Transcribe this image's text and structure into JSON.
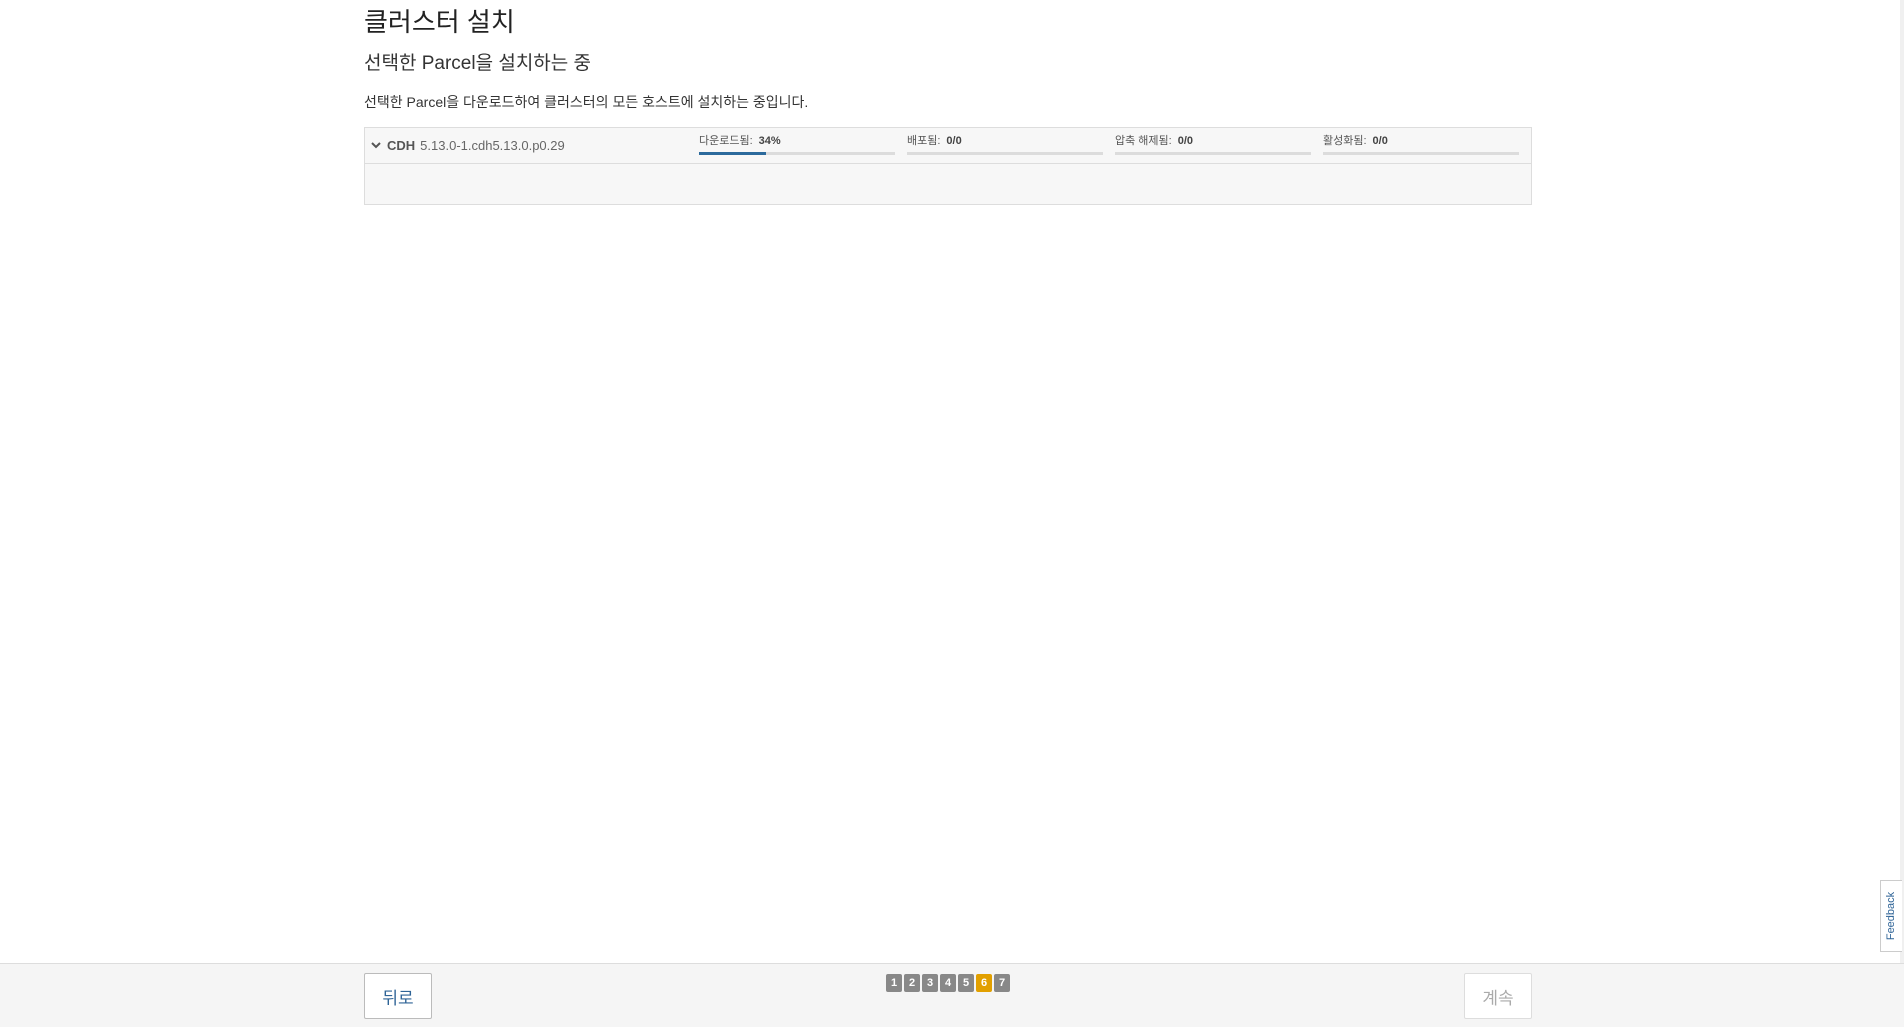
{
  "header": {
    "title": "클러스터 설치",
    "subtitle": "선택한 Parcel을 설치하는 중",
    "description": "선택한 Parcel을 다운로드하여 클러스터의 모든 호스트에 설치하는 중입니다."
  },
  "parcel": {
    "name": "CDH",
    "version": "5.13.0-1.cdh5.13.0.p0.29",
    "toggle_icon": "chevron-down-icon",
    "stages": [
      {
        "label": "다운로드됨:",
        "value": "34%",
        "progress": 0.34
      },
      {
        "label": "배포됨:",
        "value": "0/0",
        "progress": 0
      },
      {
        "label": "압축 해제됨:",
        "value": "0/0",
        "progress": 0
      },
      {
        "label": "활성화됨:",
        "value": "0/0",
        "progress": 0
      }
    ]
  },
  "footer": {
    "back_label": "뒤로",
    "continue_label": "계속",
    "steps": [
      "1",
      "2",
      "3",
      "4",
      "5",
      "6",
      "7"
    ],
    "active_step": "6"
  },
  "feedback": {
    "label": "Feedback"
  },
  "colors": {
    "progress_fill": "#2c6a9c",
    "active_step": "#e2a000",
    "link_blue": "#2f6497"
  }
}
